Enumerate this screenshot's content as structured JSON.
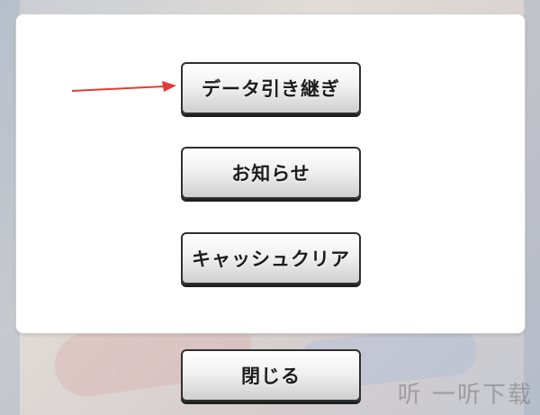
{
  "dialog": {
    "buttons": [
      {
        "label": "データ引き継ぎ"
      },
      {
        "label": "お知らせ"
      },
      {
        "label": "キャッシュクリア"
      }
    ],
    "close_label": "閉じる"
  },
  "watermark": {
    "text": "听 一听下载"
  },
  "annotation": {
    "arrow_color": "#e53935"
  }
}
